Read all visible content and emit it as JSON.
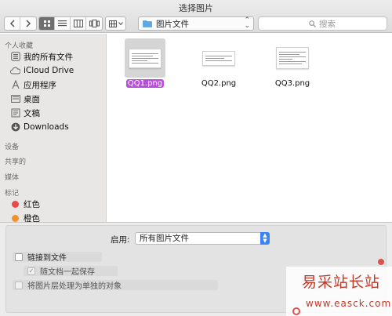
{
  "window": {
    "title": "选择图片"
  },
  "toolbar": {
    "location_label": "图片文件",
    "search_placeholder": "搜索"
  },
  "sidebar": {
    "sections": [
      {
        "title": "个人收藏"
      },
      {
        "title": "设备"
      },
      {
        "title": "共享的"
      },
      {
        "title": "媒体"
      },
      {
        "title": "标记"
      }
    ],
    "favorites": [
      {
        "label": "我的所有文件",
        "icon": "all-files-icon"
      },
      {
        "label": "iCloud Drive",
        "icon": "cloud-icon"
      },
      {
        "label": "应用程序",
        "icon": "applications-icon"
      },
      {
        "label": "桌面",
        "icon": "desktop-icon"
      },
      {
        "label": "文稿",
        "icon": "documents-icon"
      },
      {
        "label": "Downloads",
        "icon": "downloads-icon"
      }
    ],
    "tags": [
      {
        "label": "红色",
        "color": "#e84a4a"
      },
      {
        "label": "橙色",
        "color": "#f0922c"
      }
    ]
  },
  "files": [
    {
      "name": "QQ1.png",
      "selected": true
    },
    {
      "name": "QQ2.png",
      "selected": false
    },
    {
      "name": "QQ3.png",
      "selected": false
    }
  ],
  "options": {
    "enable_label": "启用:",
    "enable_value": "所有图片文件",
    "link_to_file": "链接到文件",
    "save_with_doc": "随文档一起保存",
    "treat_as_object": "将图片层处理为单独的对象"
  },
  "watermark": {
    "title": "易采站长站",
    "url": "www.easck.com"
  },
  "colors": {
    "selection": "#b94fdc",
    "accent": "#3b82f6"
  }
}
